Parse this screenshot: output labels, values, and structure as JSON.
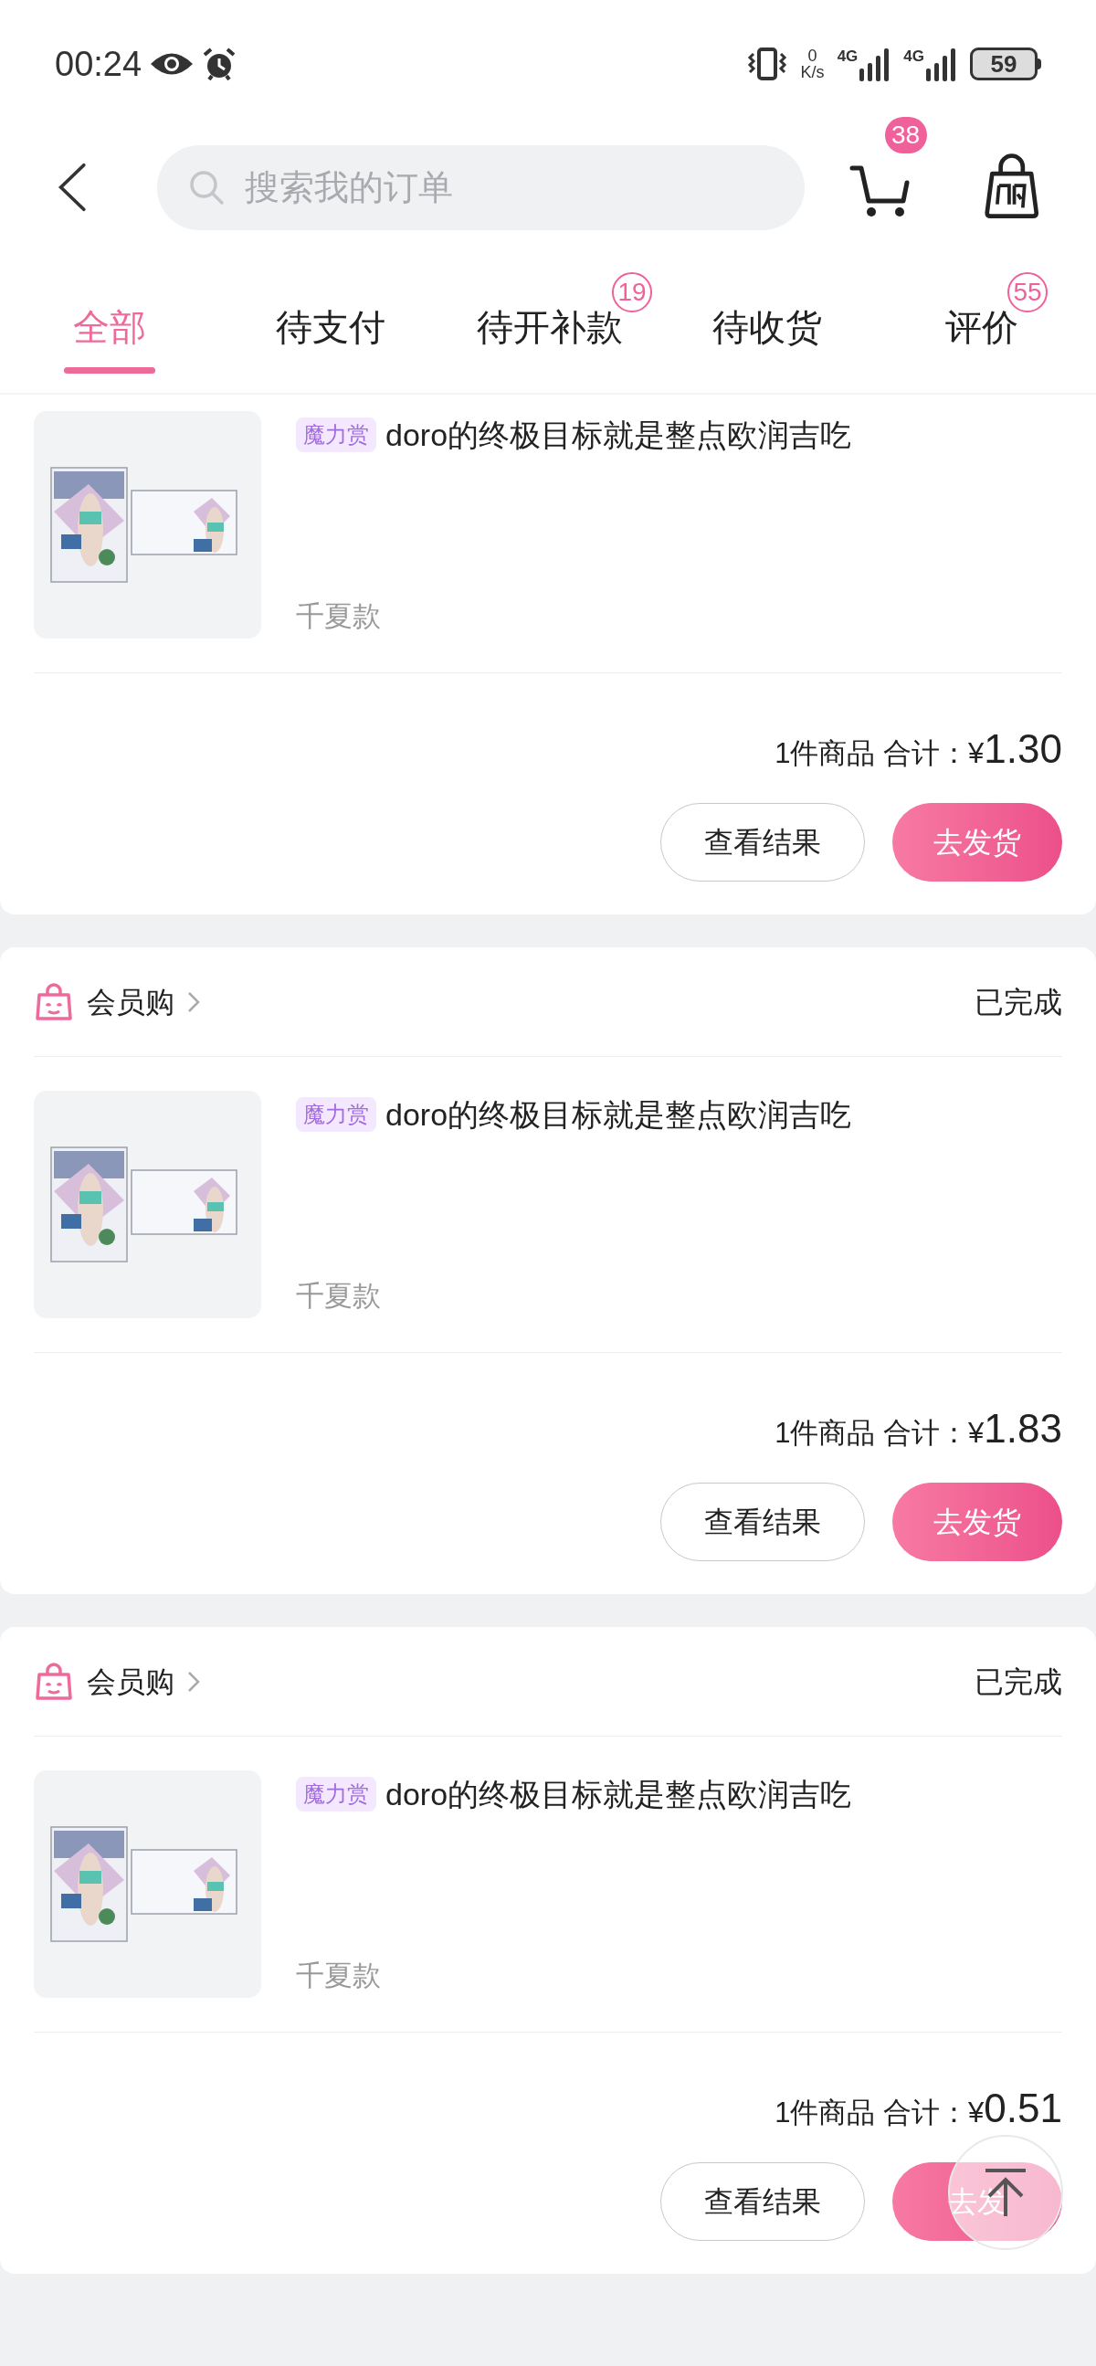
{
  "status_bar": {
    "time": "00:24",
    "net_speed_value": "0",
    "net_speed_unit": "K/s",
    "networks": [
      "4G",
      "4G"
    ],
    "battery": "59"
  },
  "header": {
    "search": {
      "placeholder": "搜索我的订单"
    },
    "cart_badge": "38"
  },
  "tabs": [
    {
      "label": "全部",
      "selected": true
    },
    {
      "label": "待支付",
      "selected": false
    },
    {
      "label": "待开补款",
      "selected": false,
      "badge": "19"
    },
    {
      "label": "待收货",
      "selected": false
    },
    {
      "label": "评价",
      "selected": false,
      "badge": "55"
    }
  ],
  "orders": [
    {
      "items": [
        {
          "tag": "魔力赏",
          "title": "doro的终极目标就是整点欧润吉吃",
          "spec": "千夏款"
        }
      ],
      "summary": "1件商品 合计：",
      "currency": "¥",
      "amount": "1.30",
      "buttons": [
        {
          "label": "查看结果",
          "kind": "outline"
        },
        {
          "label": "去发货",
          "kind": "primary"
        }
      ]
    },
    {
      "shop": "会员购",
      "status": "已完成",
      "items": [
        {
          "tag": "魔力赏",
          "title": "doro的终极目标就是整点欧润吉吃",
          "spec": "千夏款"
        }
      ],
      "summary": "1件商品 合计：",
      "currency": "¥",
      "amount": "1.83",
      "buttons": [
        {
          "label": "查看结果",
          "kind": "outline"
        },
        {
          "label": "去发货",
          "kind": "primary"
        }
      ]
    },
    {
      "shop": "会员购",
      "status": "已完成",
      "items": [
        {
          "tag": "魔力赏",
          "title": "doro的终极目标就是整点欧润吉吃",
          "spec": "千夏款"
        }
      ],
      "summary": "1件商品 合计：",
      "currency": "¥",
      "amount": "0.51",
      "buttons": [
        {
          "label": "查看结果",
          "kind": "outline"
        },
        {
          "label": "去发",
          "kind": "primary"
        }
      ]
    }
  ]
}
